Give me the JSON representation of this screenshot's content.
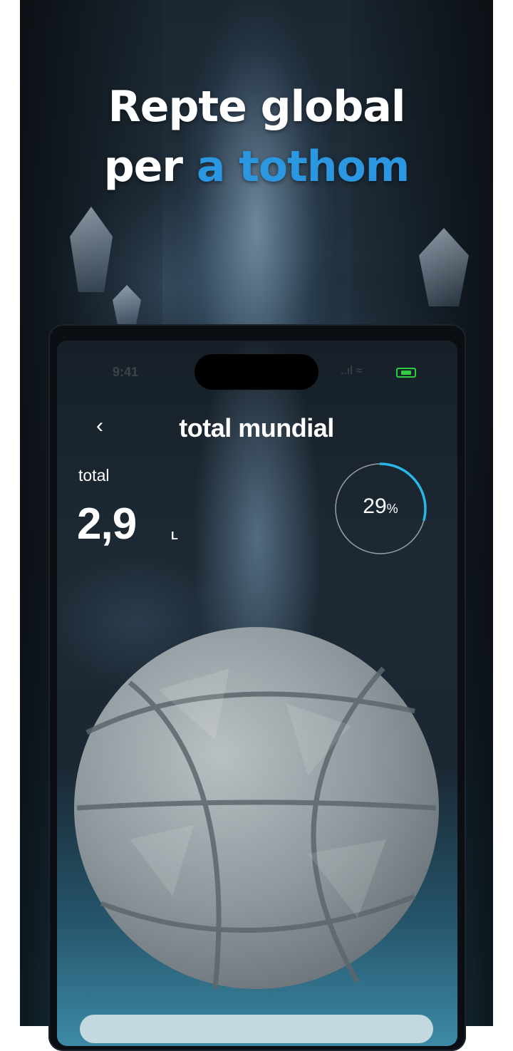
{
  "headline": {
    "line1": "Repte global",
    "line2_prefix": "per ",
    "line2_accent": "a tothom"
  },
  "status_bar": {
    "time": "9:41",
    "signal_icons": "..ıl ≈"
  },
  "screen": {
    "back_icon": "‹",
    "title": "total mundial",
    "total_label": "total",
    "total_value": "2,9",
    "total_unit": "L",
    "progress_number": "29",
    "progress_unit": "%",
    "progress_fraction": 0.29
  },
  "colors": {
    "accent": "#2a97e0",
    "progress_ring": "#29b6e6",
    "battery": "#2ecc40"
  }
}
